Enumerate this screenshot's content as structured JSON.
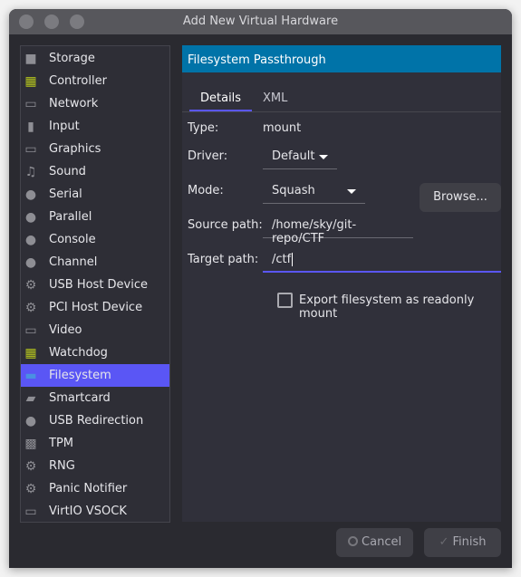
{
  "window": {
    "title": "Add New Virtual Hardware"
  },
  "sidebar": {
    "items": [
      {
        "label": "Storage",
        "icon": "storage-icon"
      },
      {
        "label": "Controller",
        "icon": "controller-icon"
      },
      {
        "label": "Network",
        "icon": "network-icon"
      },
      {
        "label": "Input",
        "icon": "mouse-icon"
      },
      {
        "label": "Graphics",
        "icon": "monitor-icon"
      },
      {
        "label": "Sound",
        "icon": "sound-icon"
      },
      {
        "label": "Serial",
        "icon": "globe-icon"
      },
      {
        "label": "Parallel",
        "icon": "globe-icon"
      },
      {
        "label": "Console",
        "icon": "globe-icon"
      },
      {
        "label": "Channel",
        "icon": "globe-icon"
      },
      {
        "label": "USB Host Device",
        "icon": "gear-icon"
      },
      {
        "label": "PCI Host Device",
        "icon": "gear-icon"
      },
      {
        "label": "Video",
        "icon": "monitor-icon"
      },
      {
        "label": "Watchdog",
        "icon": "controller-icon"
      },
      {
        "label": "Filesystem",
        "icon": "folder-icon",
        "selected": true
      },
      {
        "label": "Smartcard",
        "icon": "smartcard-icon"
      },
      {
        "label": "USB Redirection",
        "icon": "usb-icon"
      },
      {
        "label": "TPM",
        "icon": "chip-icon"
      },
      {
        "label": "RNG",
        "icon": "gear-icon"
      },
      {
        "label": "Panic Notifier",
        "icon": "gear-icon"
      },
      {
        "label": "VirtIO VSOCK",
        "icon": "network-icon"
      }
    ]
  },
  "main": {
    "header": "Filesystem Passthrough",
    "tabs": [
      {
        "label": "Details",
        "active": true
      },
      {
        "label": "XML"
      }
    ],
    "type_label": "Type:",
    "type_value": "mount",
    "driver_label": "Driver:",
    "driver_value": "Default",
    "mode_label": "Mode:",
    "mode_value": "Squash",
    "source_label": "Source path:",
    "source_value": "/home/sky/git-repo/CTF",
    "browse_label": "Browse...",
    "target_label": "Target path:",
    "target_value": "/ctf",
    "readonly_label": "Export filesystem as readonly mount",
    "readonly_checked": false
  },
  "footer": {
    "cancel": "Cancel",
    "finish": "Finish"
  },
  "colors": {
    "accent": "#5a56f5",
    "header": "#0073a8"
  }
}
